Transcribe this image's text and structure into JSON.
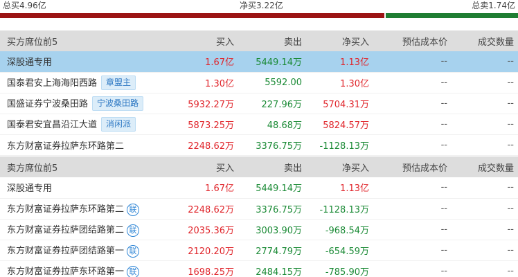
{
  "summary": {
    "buy_total": "总买4.96亿",
    "net": "净买3.22亿",
    "sell_total": "总卖1.74亿"
  },
  "colors": {
    "buy_bar": "#9b1414",
    "sell_bar": "#1f7d32",
    "positive": "#e0242a",
    "negative": "#1a8a35",
    "highlight_row": "#a7d2ee"
  },
  "buy_section": {
    "header": [
      "买方席位前5",
      "买入",
      "卖出",
      "净买入",
      "预估成本价",
      "成交数量"
    ],
    "rows": [
      {
        "name": "深股通专用",
        "tag": "",
        "lian": "",
        "buy": "1.67亿",
        "sell": "5449.14万",
        "net": "1.13亿",
        "cost": "--",
        "volume": "--"
      },
      {
        "name": "国泰君安上海海阳西路",
        "tag": "章盟主",
        "lian": "",
        "buy": "1.30亿",
        "sell": "5592.00",
        "net": "1.30亿",
        "cost": "--",
        "volume": "--"
      },
      {
        "name": "国盛证券宁波桑田路",
        "tag": "宁波桑田路",
        "lian": "",
        "buy": "5932.27万",
        "sell": "227.96万",
        "net": "5704.31万",
        "cost": "--",
        "volume": "--"
      },
      {
        "name": "国泰君安宜昌沿江大道",
        "tag": "消闲派",
        "lian": "",
        "buy": "5873.25万",
        "sell": "48.68万",
        "net": "5824.57万",
        "cost": "--",
        "volume": "--"
      },
      {
        "name": "东方财富证券拉萨东环路第二",
        "tag": "",
        "lian": "",
        "buy": "2248.62万",
        "sell": "3376.75万",
        "net": "-1128.13万",
        "cost": "--",
        "volume": "--"
      }
    ]
  },
  "sell_section": {
    "header": [
      "卖方席位前5",
      "买入",
      "卖出",
      "净买入",
      "预估成本价",
      "成交数量"
    ],
    "rows": [
      {
        "name": "深股通专用",
        "tag": "",
        "lian": "",
        "buy": "1.67亿",
        "sell": "5449.14万",
        "net": "1.13亿",
        "cost": "--",
        "volume": "--"
      },
      {
        "name": "东方财富证券拉萨东环路第二",
        "tag": "",
        "lian": "联",
        "buy": "2248.62万",
        "sell": "3376.75万",
        "net": "-1128.13万",
        "cost": "--",
        "volume": "--"
      },
      {
        "name": "东方财富证券拉萨团结路第二",
        "tag": "",
        "lian": "联",
        "buy": "2035.36万",
        "sell": "3003.90万",
        "net": "-968.54万",
        "cost": "--",
        "volume": "--"
      },
      {
        "name": "东方财富证券拉萨团结路第一",
        "tag": "",
        "lian": "联",
        "buy": "2120.20万",
        "sell": "2774.79万",
        "net": "-654.59万",
        "cost": "--",
        "volume": "--"
      },
      {
        "name": "东方财富证券拉萨东环路第一",
        "tag": "",
        "lian": "联",
        "buy": "1698.25万",
        "sell": "2484.15万",
        "net": "-785.90万",
        "cost": "--",
        "volume": "--"
      }
    ]
  }
}
